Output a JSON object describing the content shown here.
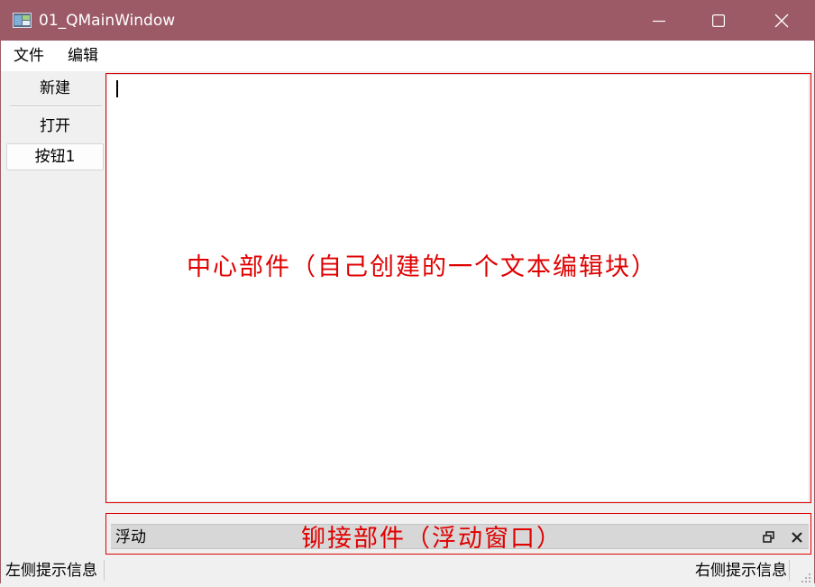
{
  "window": {
    "title": "01_QMainWindow"
  },
  "colors": {
    "titlebar": "#9c5a66",
    "annotation": "#e00000"
  },
  "menubar": {
    "items": [
      "文件",
      "编辑"
    ]
  },
  "toolbar": {
    "new_label": "新建",
    "open_label": "打开",
    "button1_label": "按钮1"
  },
  "central": {
    "annotation": "中心部件（自己创建的一个文本编辑块）",
    "text": ""
  },
  "dock": {
    "title": "浮动",
    "annotation": "铆接部件（浮动窗口）"
  },
  "statusbar": {
    "left_text": "左侧提示信息",
    "right_text": "右侧提示信息"
  },
  "icons": {
    "app": "app-window-icon",
    "minimize": "minimize-icon",
    "maximize": "maximize-icon",
    "close": "close-icon",
    "dock_float": "float-restore-icon",
    "dock_close": "dock-close-icon",
    "grip": "size-grip-icon"
  }
}
